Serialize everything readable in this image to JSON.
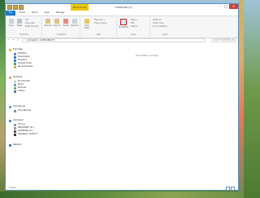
{
  "window": {
    "title": "SAMSUNG (F:)",
    "context_tab": "Drive Tools",
    "minimize": "–",
    "maximize": "□",
    "close": "✕"
  },
  "ribbon_tabs": [
    "File",
    "Home",
    "Share",
    "View",
    "Manage"
  ],
  "ribbon": {
    "clipboard": {
      "name": "Clipboard",
      "copy": "Copy",
      "paste": "Paste",
      "cut": "Cut",
      "copy_path": "Copy path",
      "paste_shortcut": "Paste shortcut"
    },
    "organize": {
      "name": "Organize",
      "move_to": "Move to",
      "copy_to": "Copy to",
      "delete": "Delete",
      "rename": "Rename"
    },
    "new": {
      "name": "New",
      "new_folder": "New folder",
      "new_item": "New item ▾",
      "easy_access": "Easy access ▾"
    },
    "open": {
      "name": "Open",
      "properties": "Properties",
      "open": "Open ▾",
      "edit": "Edit",
      "history": "History"
    },
    "select": {
      "name": "Select",
      "select_all": "Select all",
      "select_none": "Select none",
      "invert_selection": "Invert selection"
    }
  },
  "address": {
    "back": "←",
    "forward": "→",
    "up": "↑",
    "path": "›  Computer  ›  SAMSUNG (F:)",
    "search_placeholder": "Search SAMSUNG (F:)"
  },
  "nav": {
    "favorites": {
      "label": "Favorites",
      "items": [
        "Desktop",
        "Downloads",
        "Dropbox",
        "Google Drive",
        "Recent places"
      ]
    },
    "libraries": {
      "label": "Libraries",
      "items": [
        "Documents",
        "Music",
        "Pictures",
        "Videos"
      ]
    },
    "homegroup": {
      "label": "Homegroup",
      "items": [
        "Tony Barrow"
      ]
    },
    "computer": {
      "label": "Computer",
      "items": [
        "OS (C:)",
        "RECOVERY (D:)",
        "SAMSUNG (F:)",
        "Headgear Goflex 3"
      ]
    },
    "network": {
      "label": "Network"
    }
  },
  "content": {
    "empty_message": "This folder is empty."
  },
  "status": {
    "items": "0 items"
  },
  "colors": {
    "accent": "#1979ca",
    "context_tab": "#f0c808",
    "close": "#c7453a"
  }
}
